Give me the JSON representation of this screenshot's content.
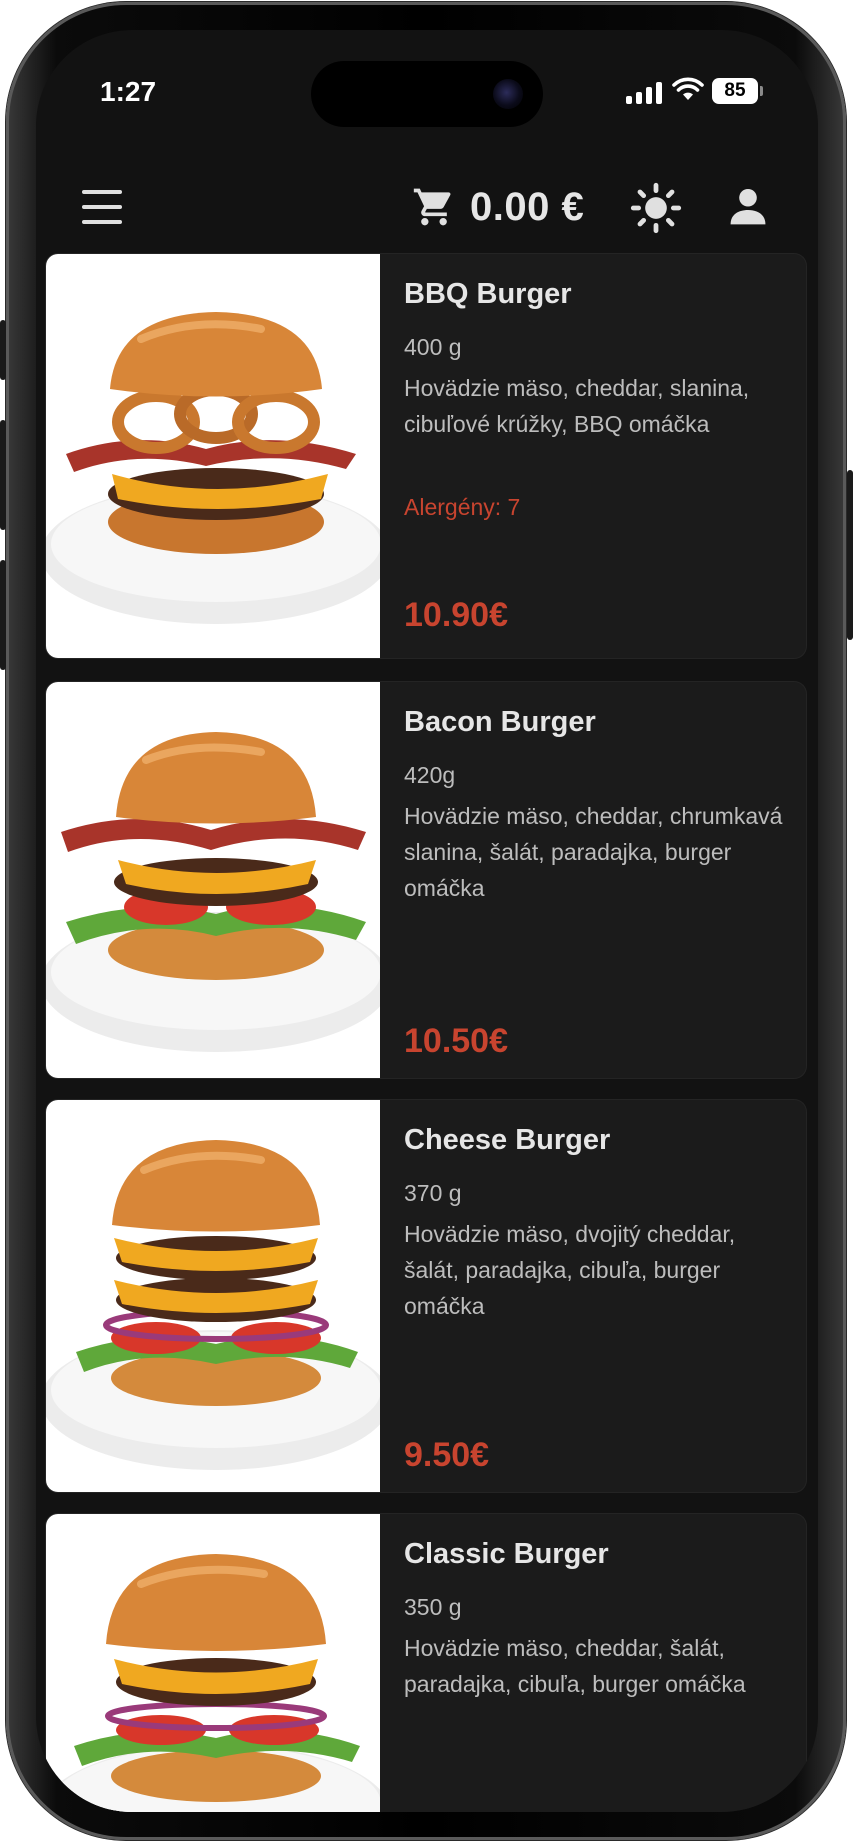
{
  "status_bar": {
    "time": "1:27",
    "battery": "85"
  },
  "header": {
    "menu_icon": "hamburger-menu-icon",
    "cart_icon": "shopping-cart-icon",
    "cart_total": "0.00 €",
    "theme_icon": "sun-icon",
    "user_icon": "user-icon"
  },
  "colors": {
    "background": "#121212",
    "card": "#1b1b1b",
    "accent": "#c8442f",
    "text_primary": "#e6e6e6",
    "text_secondary": "#bdbdbd"
  },
  "products": [
    {
      "name": "BBQ Burger",
      "weight": "400 g",
      "description": "Hovädzie mäso, cheddar, slanina, cibuľové krúžky, BBQ omáčka",
      "allergens": "Alergény: 7",
      "price": "10.90€"
    },
    {
      "name": "Bacon Burger",
      "weight": "420g",
      "description": "Hovädzie mäso, cheddar, chrumkavá slanina, šalát, paradajka, burger omáčka",
      "price": "10.50€"
    },
    {
      "name": "Cheese Burger",
      "weight": "370 g",
      "description": "Hovädzie mäso, dvojitý cheddar, šalát, paradajka, cibuľa, burger omáčka",
      "price": "9.50€"
    },
    {
      "name": "Classic Burger",
      "weight": "350 g",
      "description": "Hovädzie mäso, cheddar, šalát, paradajka, cibuľa, burger omáčka"
    }
  ]
}
